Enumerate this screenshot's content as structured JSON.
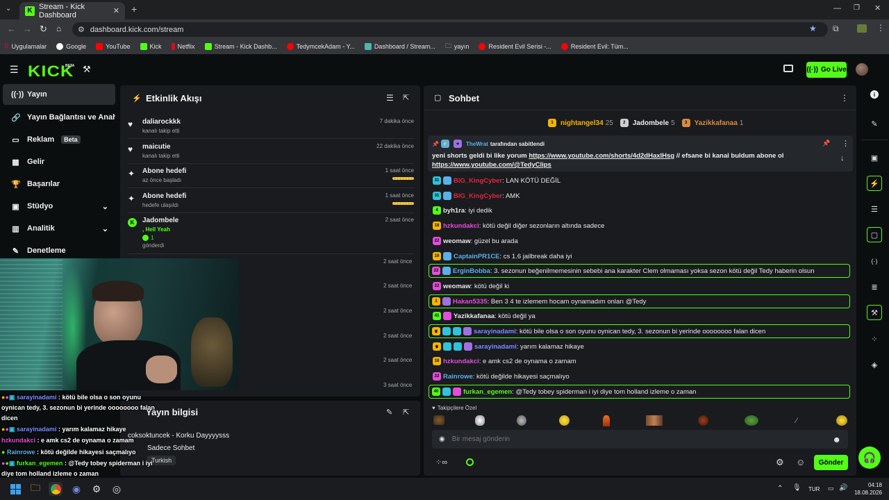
{
  "browser": {
    "tab_title": "Stream - Kick Dashboard",
    "url": "dashboard.kick.com/stream",
    "bookmarks": [
      "Uygulamalar",
      "Google",
      "YouTube",
      "Kick",
      "Netflix",
      "Stream - Kick Dashb...",
      "TedymcekAdam - Y...",
      "Dashboard / Stream...",
      "yayın",
      "Resident Evil Serisi -...",
      "Resident Evil: Tüm..."
    ]
  },
  "topbar": {
    "logo": "KICK",
    "logo_beta": "BETA",
    "go_live": "Go Live"
  },
  "sidebar": {
    "items": [
      {
        "label": "Yayın",
        "icon": "((·))"
      },
      {
        "label": "Yayın Bağlantısı ve Anahtarı",
        "icon": "🔗"
      },
      {
        "label": "Reklam",
        "icon": "▭",
        "badge": "Beta"
      },
      {
        "label": "Gelir",
        "icon": "▦"
      },
      {
        "label": "Başarılar",
        "icon": "🏆"
      },
      {
        "label": "Stüdyo",
        "icon": "▣"
      },
      {
        "label": "Analitik",
        "icon": "▥"
      },
      {
        "label": "Denetleme",
        "icon": "✎"
      }
    ]
  },
  "activity": {
    "title": "Etkinlik Akışı",
    "events": [
      {
        "name": "daliarockkk",
        "sub": "kanalı takip etti",
        "time": "7 dakika önce",
        "icon": "♥"
      },
      {
        "name": "maicutie",
        "sub": "kanalı takip etti",
        "time": "22 dakika önce",
        "icon": "♥"
      },
      {
        "name": "Abone hedefi",
        "sub": "az önce başladı",
        "time": "1 saat önce",
        "icon": "✦"
      },
      {
        "name": "Abone hedefi",
        "sub": "hedefe ulaşıldı",
        "time": "1 saat önce",
        "icon": "✦"
      },
      {
        "name": "Jadombele",
        "line2": ", Hell Yeah",
        "count": "1",
        "sub": "gönderdi",
        "time": "2 saat önce",
        "icon": "K"
      }
    ],
    "hidden_times": [
      "2 saat önce",
      "2 saat önce",
      "2 saat önce",
      "2 saat önce",
      "2 saat önce",
      "3 saat önce"
    ]
  },
  "stream_info": {
    "title": "Yayın bilgisi",
    "stream_title": "coksoktuncek - Korku Dayyyysss",
    "chat_mode": "Sadece Sohbet",
    "language": "Turkish"
  },
  "chat": {
    "title": "Sohbet",
    "leaderboard": [
      {
        "name": "nightangel34",
        "count": "25",
        "color": "#f4b400"
      },
      {
        "name": "Jadombele",
        "count": "5",
        "color": "#cfcfcf"
      },
      {
        "name": "Yazikkafanaa",
        "count": "1",
        "color": "#d98a3c"
      }
    ],
    "pinned": {
      "user": "TheWrat",
      "by": "tarafından sabitlendi",
      "text": "yeni shorts geldi bi like yorum ",
      "link1": "https://www.youtube.com/shorts/4d2dHaxlHsg",
      "mid": " // efsane bi kanal buldum abone ol",
      "link2": "https://www.youtube.com/@TedyClips"
    },
    "messages": [
      {
        "user": "BIG_KingCyber",
        "color": "#e0283c",
        "text": ": LAN KÖTÜ DEĞİL",
        "badges": [
          "#2ec4d9",
          "#5ab0e8"
        ],
        "badge_text": "31"
      },
      {
        "user": "BIG_KingCyber",
        "color": "#e0283c",
        "text": ": AMK",
        "badges": [
          "#2ec4d9",
          "#5ab0e8"
        ],
        "badge_text": "31"
      },
      {
        "user": "byh1ra",
        "color": "#e8e8e8",
        "text": ": iyi dedik",
        "badges": [
          "#53fc18"
        ],
        "badge_text": "4"
      },
      {
        "user": "hzkundakci",
        "color": "#e34dd8",
        "text": ": kötü değil diğer sezonların altında sadece",
        "badges": [
          "#f4b400"
        ],
        "badge_text": "18"
      },
      {
        "user": "weomaw",
        "color": "#e8e8e8",
        "text": ": güzel bu arada",
        "badges": [
          "#e34dd8"
        ],
        "badge_text": "22"
      },
      {
        "user": "CaptainPR1CE",
        "color": "#5ab0e8",
        "text": ": cs 1.6 jailbreak daha iyi",
        "badges": [
          "#f4b400",
          "#5ab0e8"
        ],
        "badge_text": "19"
      },
      {
        "user": "ErginBobba",
        "color": "#5ab0e8",
        "text": ": 3. sezonun beğenilmemesinin sebebi ana karakter Clem olmaması yoksa sezon kötü değil Tedy haberin olsun",
        "badges": [
          "#e34dd8",
          "#5ab0e8"
        ],
        "badge_text": "22",
        "hl": true
      },
      {
        "user": "weomaw",
        "color": "#e8e8e8",
        "text": ": kötü değil ki",
        "badges": [
          "#e34dd8"
        ],
        "badge_text": "22"
      },
      {
        "user": "Hakan5335",
        "color": "#e34dd8",
        "text": ": Ben 3 4 te izlemem hocam oynamadım onları @Tedy",
        "badges": [
          "#f4b400",
          "#a070e0"
        ],
        "badge_text": "1",
        "hl": true
      },
      {
        "user": "Yazikkafanaa",
        "color": "#e8e8e8",
        "text": ": kötü değil ya",
        "badges": [
          "#53fc18",
          "#e34dd8"
        ],
        "badge_text": "41"
      },
      {
        "user": "sarayinadami",
        "color": "#7a8cff",
        "text": ": kötü bile olsa o son oyunu oynican tedy, 3. sezonun bi yerinde oooooooo falan dicen",
        "badges": [
          "#f4b400",
          "#2ec4d9",
          "#2ec4d9",
          "#a070e0"
        ],
        "badge_text": "♛",
        "hl": true
      },
      {
        "user": "sarayinadami",
        "color": "#7a8cff",
        "text": ": yarım kalamaz hikaye",
        "badges": [
          "#f4b400",
          "#2ec4d9",
          "#2ec4d9",
          "#a070e0"
        ],
        "badge_text": "♛"
      },
      {
        "user": "hzkundakci",
        "color": "#e34dd8",
        "text": ": e amk cs2 de oynama o zamam",
        "badges": [
          "#f4b400"
        ],
        "badge_text": "18"
      },
      {
        "user": "Rainrowe",
        "color": "#5ab0e8",
        "text": ": kötü değilde hikayesi saçmalıyo",
        "badges": [
          "#e34dd8"
        ],
        "badge_text": "22"
      },
      {
        "user": "furkan_egemen",
        "color": "#53fc18",
        "text": ": @Tedy tobey spiderman i iyi diye tom holland izleme o zaman",
        "badges": [
          "#53fc18",
          "#2ec4d9",
          "#e34dd8"
        ],
        "badge_text": "40",
        "hl": true
      }
    ],
    "emote_section": "Takipçilere Özel",
    "input_placeholder": "Bir mesaj gönderin",
    "send": "Gönder"
  },
  "overlay_chat": [
    {
      "user": "sarayinadami",
      "text": " : kötü bile olsa o son oyunu"
    },
    {
      "user": "",
      "text": "oynican tedy, 3. sezonun bi yerinde oooooooo falan"
    },
    {
      "user": "",
      "text": "dicen"
    },
    {
      "user": "sarayinadami",
      "text": " : yarım kalamaz hikaye"
    },
    {
      "user": "hzkundakci",
      "text": " : e amk cs2 de oynama o zamam"
    },
    {
      "user": "Rainrowe",
      "text": " : kötü değilde hikayesi saçmalıyo"
    },
    {
      "user": "furkan_egemen",
      "text": " : @Tedy tobey spiderman i iyi"
    },
    {
      "user": "",
      "text": "diye tom holland izleme o zaman"
    }
  ],
  "taskbar": {
    "lang": "TUR",
    "time": "04:18",
    "date": "18.08.2026"
  },
  "colors": {
    "accent": "#53fc18",
    "panel": "#191b1f",
    "bg": "#0b0e0f"
  }
}
